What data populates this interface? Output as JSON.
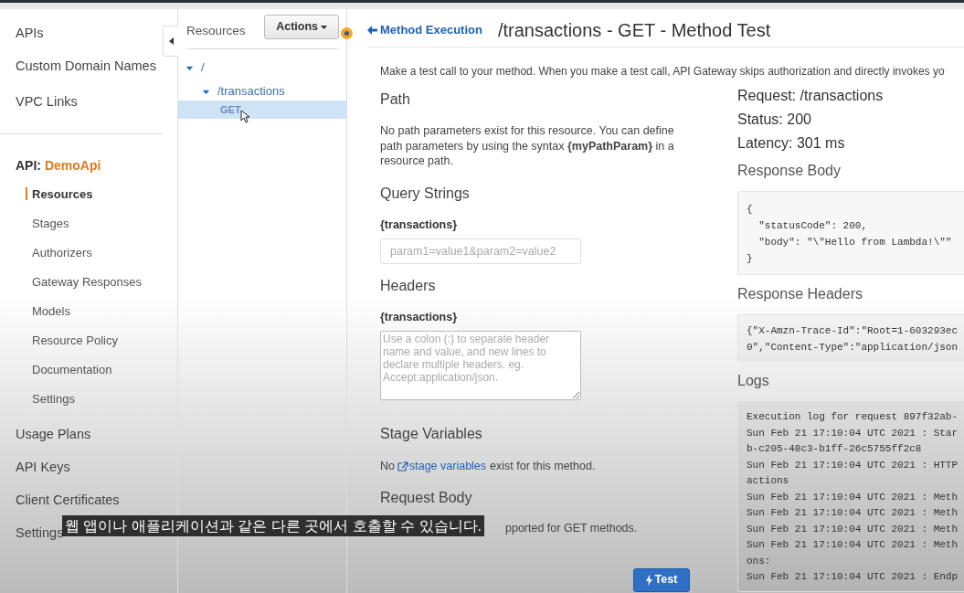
{
  "sidebar": {
    "top_items": [
      {
        "label": "APIs"
      },
      {
        "label": "Custom Domain Names"
      },
      {
        "label": "VPC Links"
      }
    ],
    "api_label": "API:",
    "api_name": "DemoApi",
    "api_items": [
      {
        "label": "Resources",
        "selected": true
      },
      {
        "label": "Stages",
        "selected": false
      },
      {
        "label": "Authorizers",
        "selected": false
      },
      {
        "label": "Gateway Responses",
        "selected": false
      },
      {
        "label": "Models",
        "selected": false
      },
      {
        "label": "Resource Policy",
        "selected": false
      },
      {
        "label": "Documentation",
        "selected": false
      },
      {
        "label": "Settings",
        "selected": false
      }
    ],
    "bottom_items": [
      {
        "label": "Usage Plans"
      },
      {
        "label": "API Keys"
      },
      {
        "label": "Client Certificates"
      },
      {
        "label": "Settings"
      }
    ]
  },
  "resources": {
    "title": "Resources",
    "actions_button": "Actions",
    "tree": [
      {
        "label": "/",
        "expanded": true,
        "selected": false,
        "children": [
          {
            "label": "/transactions",
            "expanded": true,
            "selected": false,
            "children": [
              {
                "label": "GET",
                "selected": true
              }
            ]
          }
        ]
      }
    ]
  },
  "header": {
    "back_link": "Method Execution",
    "title": "/transactions - GET - Method Test"
  },
  "intro": "Make a test call to your method. When you make a test call, API Gateway skips authorization and directly invokes yo",
  "form": {
    "path_heading": "Path",
    "path_text": "No path parameters exist for this resource. You can define path parameters by using the syntax **{myPathParam}** in a resource path.",
    "query_heading": "Query Strings",
    "query_label": "{transactions}",
    "query_placeholder": "param1=value1&param2=value2",
    "headers_heading": "Headers",
    "headers_label": "{transactions}",
    "headers_placeholder": "Use a colon (:) to separate header name and value, and new lines to declare multiple headers. eg. Accept:application/json.",
    "stage_heading": "Stage Variables",
    "stage_prefix": "No",
    "stage_link": "stage variables",
    "stage_suffix": "exist for this method.",
    "body_heading": "Request Body",
    "body_text": "pported for GET methods.",
    "test_button": "Test"
  },
  "result": {
    "request": "Request: /transactions",
    "status": "Status: 200",
    "latency": "Latency: 301 ms",
    "body_heading": "Response Body",
    "body_lines": [
      "{",
      "  \"statusCode\": 200,",
      "  \"body\": \"\\\"Hello from Lambda!\\\"\"",
      "}"
    ],
    "headers_heading": "Response Headers",
    "headers_lines": [
      "{\"X-Amzn-Trace-Id\":\"Root=1-603293ec",
      "0\",\"Content-Type\":\"application/json"
    ],
    "logs_heading": "Logs",
    "log_lines": [
      "Execution log for request 897f32ab-",
      "Sun Feb 21 17:10:04 UTC 2021 : Star",
      "b-c205-48c3-b1ff-26c5755ff2c8",
      "Sun Feb 21 17:10:04 UTC 2021 : HTTP",
      "actions",
      "Sun Feb 21 17:10:04 UTC 2021 : Meth",
      "Sun Feb 21 17:10:04 UTC 2021 : Meth",
      "Sun Feb 21 17:10:04 UTC 2021 : Meth",
      "Sun Feb 21 17:10:04 UTC 2021 : Meth",
      "ons:",
      "Sun Feb 21 17:10:04 UTC 2021 : Endp"
    ]
  },
  "subtitle": "웹 앱이나 애플리케이션과 같은 다른 곳에서 호출할 수 있습니다."
}
